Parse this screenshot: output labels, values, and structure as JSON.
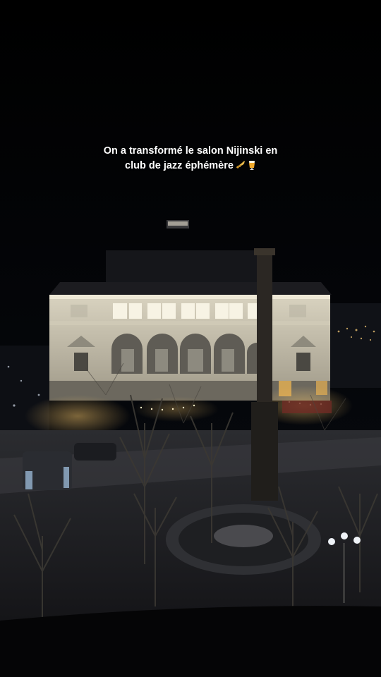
{
  "caption": {
    "line1": "On a transformé le salon Nijinski en",
    "line2": "club de jazz éphémère"
  },
  "emojis": [
    "trumpet-icon",
    "beer-glass-icon"
  ],
  "colors": {
    "background": "#000000",
    "facade_light": "#e8e2cf",
    "window_glow": "#f7f3e4",
    "warm_lights": "#f4c46a",
    "caption_text": "#ffffff"
  }
}
